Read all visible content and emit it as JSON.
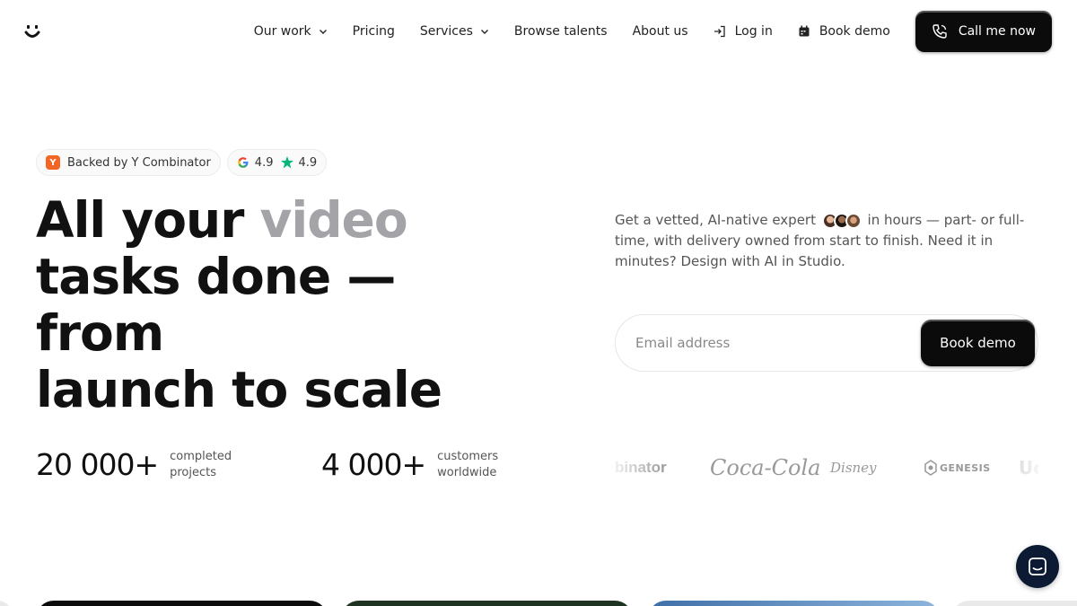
{
  "brand": {
    "logo_icon": "smile-icon"
  },
  "nav": {
    "our_work": "Our work",
    "pricing": "Pricing",
    "services": "Services",
    "browse_talents": "Browse talents",
    "about_us": "About us",
    "log_in": "Log in",
    "book_demo": "Book demo",
    "call_me_now": "Call me now"
  },
  "badges": {
    "yc_letter": "Y",
    "yc_text": "Backed by Y Combinator",
    "google_rating": "4.9",
    "trustpilot_rating": "4.9"
  },
  "hero": {
    "line1_a": "All your ",
    "line1_b": "video",
    "line2": "tasks done — from",
    "line3": "launch to scale"
  },
  "subtext": {
    "part1": "Get a vetted, AI-native expert",
    "part2": "in hours — part- or full-time, with delivery owned from start to finish. Need it in minutes? Design with AI in Studio."
  },
  "form": {
    "email_placeholder": "Email address",
    "submit_label": "Book demo"
  },
  "stats": [
    {
      "value": "20 000+",
      "label": "completed projects"
    },
    {
      "value": "4 000+",
      "label": "customers worldwide"
    }
  ],
  "client_logos": {
    "yc": "binator",
    "coke": "Coca-Cola",
    "disney": "Disney",
    "genesis": "GENESIS",
    "partial": "Uc"
  },
  "colors": {
    "accent_dark": "#0b0b0b",
    "muted_heading": "#a3a3a8",
    "yc_orange": "#f26522",
    "trustpilot_green": "#00b67a",
    "chat_bg": "#0c1a33"
  }
}
